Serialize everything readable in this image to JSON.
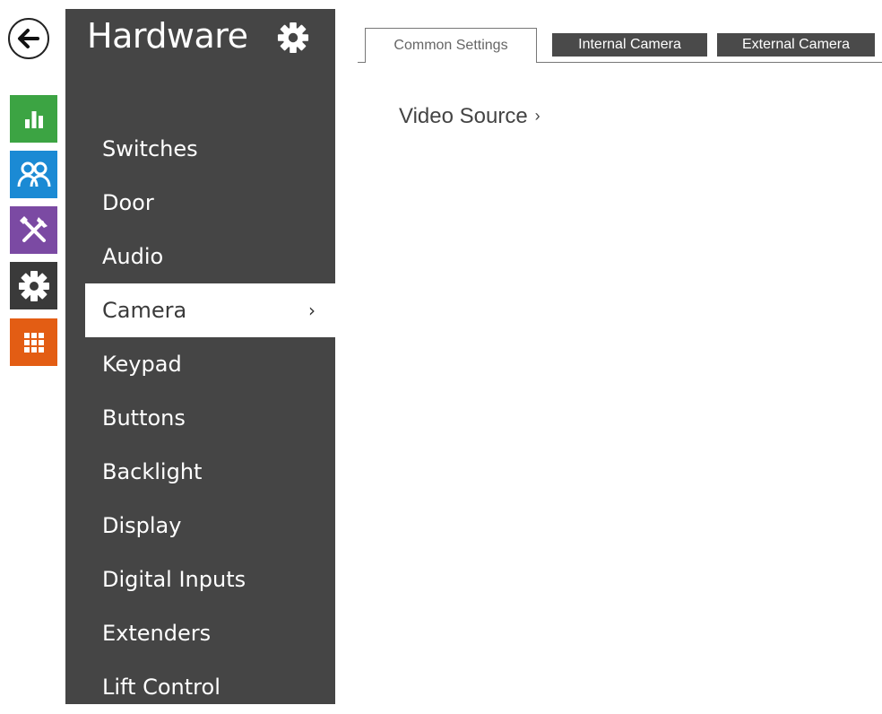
{
  "rail": {
    "back": {
      "icon": "arrow-left-icon"
    },
    "tiles": [
      {
        "name": "status",
        "icon": "bar-chart-icon",
        "color": "#3ca443"
      },
      {
        "name": "directory",
        "icon": "users-icon",
        "color": "#1b8ad4"
      },
      {
        "name": "hardware",
        "icon": "tools-icon",
        "color": "#7b4aa3"
      },
      {
        "name": "system",
        "icon": "gear-icon",
        "color": "#3a3a3a"
      },
      {
        "name": "services",
        "icon": "grid-icon",
        "color": "#e35d14"
      }
    ]
  },
  "sidebar": {
    "title": "Hardware",
    "items": [
      {
        "label": "Switches"
      },
      {
        "label": "Door"
      },
      {
        "label": "Audio"
      },
      {
        "label": "Camera",
        "active": true
      },
      {
        "label": "Keypad"
      },
      {
        "label": "Buttons"
      },
      {
        "label": "Backlight"
      },
      {
        "label": "Display"
      },
      {
        "label": "Digital Inputs"
      },
      {
        "label": "Extenders"
      },
      {
        "label": "Lift Control"
      }
    ],
    "active_chevron": "›"
  },
  "tabs": [
    {
      "label": "Common Settings",
      "active": true
    },
    {
      "label": "Internal Camera"
    },
    {
      "label": "External Camera"
    }
  ],
  "main": {
    "section_link": "Video Source",
    "section_chevron": "›"
  },
  "colors": {
    "sidebar_bg": "#454545",
    "tab_inactive_bg": "#4a4a4a"
  }
}
